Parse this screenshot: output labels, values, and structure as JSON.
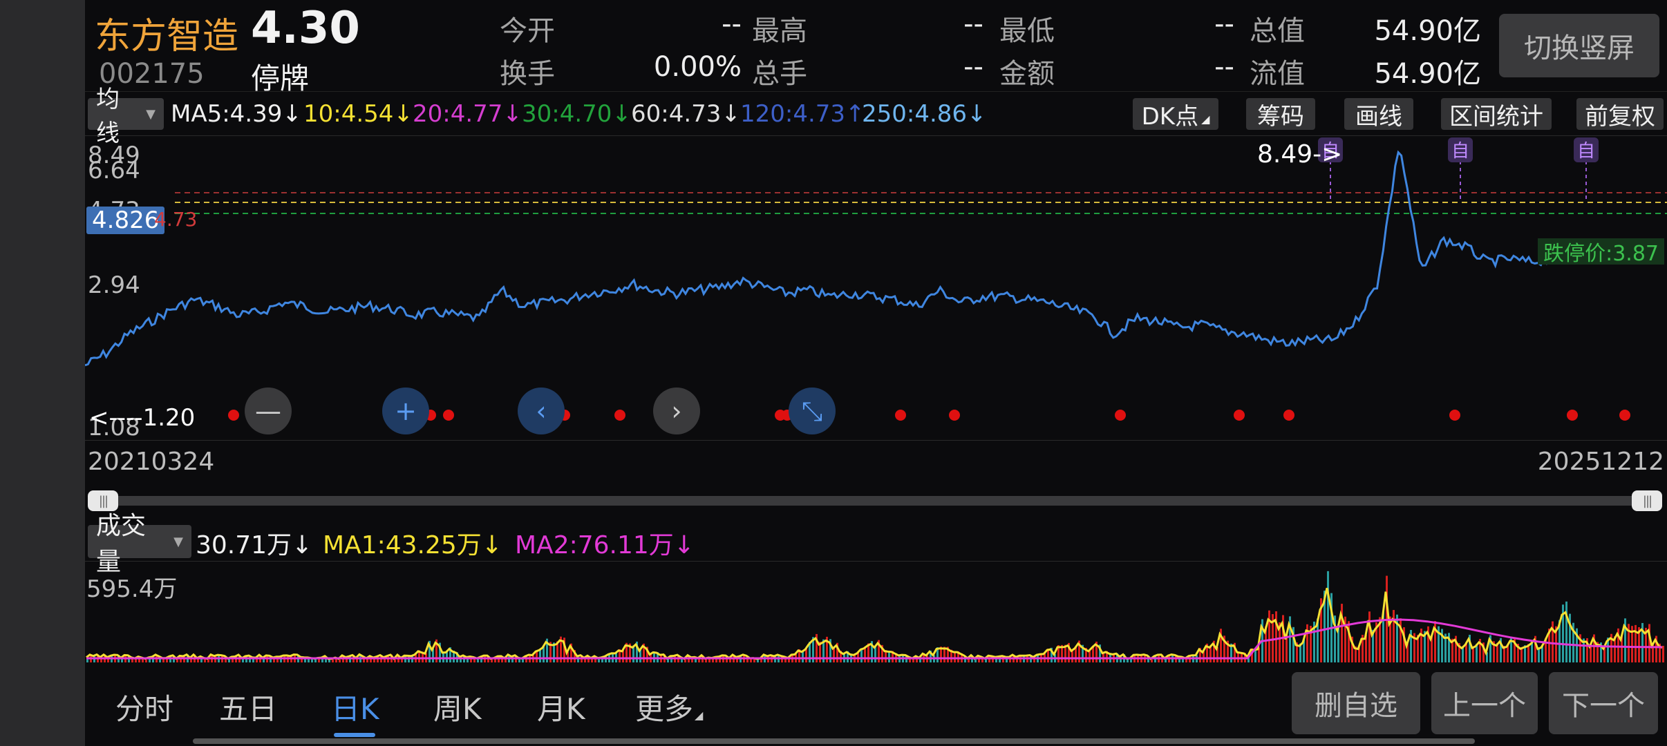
{
  "header": {
    "name": "东方智造",
    "price": "4.30",
    "code": "002175",
    "status": "停牌",
    "switch_label": "切换竖屏",
    "quotes": [
      {
        "label": "今开",
        "value": "--"
      },
      {
        "label": "最高",
        "value": "--"
      },
      {
        "label": "最低",
        "value": "--"
      },
      {
        "label": "总值",
        "value": "54.90亿"
      },
      {
        "label": "换手",
        "value": "0.00%"
      },
      {
        "label": "总手",
        "value": "--"
      },
      {
        "label": "金额",
        "value": "--"
      },
      {
        "label": "流值",
        "value": "54.90亿"
      }
    ]
  },
  "ma_bar": {
    "selector": "均线",
    "items": [
      {
        "text": "MA5:4.39↓",
        "color": "#f0f0f0"
      },
      {
        "text": "10:4.54↓",
        "color": "#f5e133"
      },
      {
        "text": "20:4.77↓",
        "color": "#d53ed0"
      },
      {
        "text": "30:4.70↓",
        "color": "#22a33c"
      },
      {
        "text": "60:4.73↓",
        "color": "#e0e0e0"
      },
      {
        "text": "120:4.73↑",
        "color": "#3d5fc8"
      },
      {
        "text": "250:4.86↓",
        "color": "#6fb6ef"
      }
    ],
    "tools": [
      "DK点",
      "筹码",
      "画线",
      "区间统计",
      "前复权"
    ]
  },
  "chart": {
    "y_labels": [
      "8.49",
      "6.64",
      "4.73",
      "2.94",
      "1.08"
    ],
    "current_price_tag": "4.826",
    "ma_tag": "4.73",
    "limit_down": "跌停价:3.87",
    "high_marker": "8.49->",
    "low_marker": "<----1.20",
    "self_markers": [
      "自",
      "自",
      "自"
    ],
    "date_start": "20210324",
    "date_end": "20251212",
    "zoom_icons": [
      "minus-icon",
      "plus-icon",
      "chevron-left-icon",
      "chevron-right-icon",
      "compress-icon"
    ],
    "line_color": "#3f86e0"
  },
  "chart_data": {
    "type": "line",
    "title": "",
    "x_range": [
      "20210324",
      "20251212"
    ],
    "ylim": [
      1.08,
      8.49
    ],
    "series": [
      {
        "name": "",
        "values": [
          1.2,
          1.6,
          2.2,
          2.6,
          3.0,
          3.3,
          3.1,
          2.8,
          2.9,
          3.2,
          3.1,
          2.9,
          3.0,
          3.1,
          3.0,
          2.8,
          2.9,
          2.8,
          2.7,
          3.6,
          3.1,
          3.2,
          3.3,
          3.5,
          3.6,
          3.8,
          3.6,
          3.5,
          3.6,
          3.7,
          3.9,
          3.7,
          3.5,
          3.6,
          3.4,
          3.5,
          3.4,
          3.3,
          3.1,
          3.6,
          3.2,
          3.4,
          3.4,
          3.3,
          3.2,
          3.0,
          2.8,
          2.2,
          2.7,
          2.6,
          2.4,
          2.5,
          2.3,
          2.2,
          2.0,
          1.9,
          2.0,
          2.0,
          2.6,
          3.8,
          8.3,
          4.2,
          5.2,
          5.0,
          4.5,
          4.6,
          4.5,
          4.6,
          4.7,
          5.0,
          4.6,
          4.7,
          4.8
        ]
      }
    ],
    "buy_signals": 22,
    "volume": {
      "max_label": "595.4万",
      "current": "30.71万↓",
      "ma1": "MA1:43.25万↓",
      "ma2": "MA2:76.11万↓"
    }
  },
  "volume_bar": {
    "selector": "成交量",
    "current": "30.71万↓",
    "ma1": "MA1:43.25万↓",
    "ma2": "MA2:76.11万↓",
    "max_label": "595.4万",
    "colors": {
      "current": "#f0f0f0",
      "ma1": "#f5e133",
      "ma2": "#e23ad6"
    }
  },
  "tabs": {
    "items": [
      "分时",
      "五日",
      "日K",
      "周K",
      "月K",
      "更多"
    ],
    "active": "日K",
    "buttons": [
      "删自选",
      "上一个",
      "下一个"
    ]
  }
}
